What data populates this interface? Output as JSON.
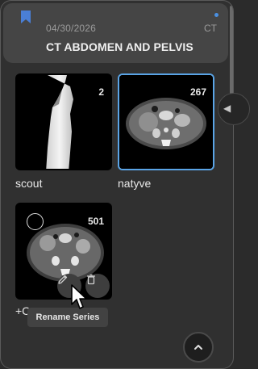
{
  "study": {
    "date": "04/30/2026",
    "modality": "CT",
    "title": "CT ABDOMEN AND PELVIS",
    "bookmark_icon": "bookmark-icon",
    "accent_color": "#4a90e2"
  },
  "series": [
    {
      "label": "scout",
      "instance_count": "2",
      "selected": false
    },
    {
      "label": "natyve",
      "instance_count": "267",
      "selected": true
    },
    {
      "label": "+C",
      "instance_count": "501",
      "selected": false,
      "hovered": true
    }
  ],
  "hover_actions": {
    "edit_icon": "pencil-icon",
    "delete_icon": "trash-icon"
  },
  "tooltip": {
    "text": "Rename Series"
  },
  "selection_color": "#5aa4e6",
  "scroll_top_icon": "chevron-up-icon",
  "side_tab_icon": "chevron-left-icon"
}
